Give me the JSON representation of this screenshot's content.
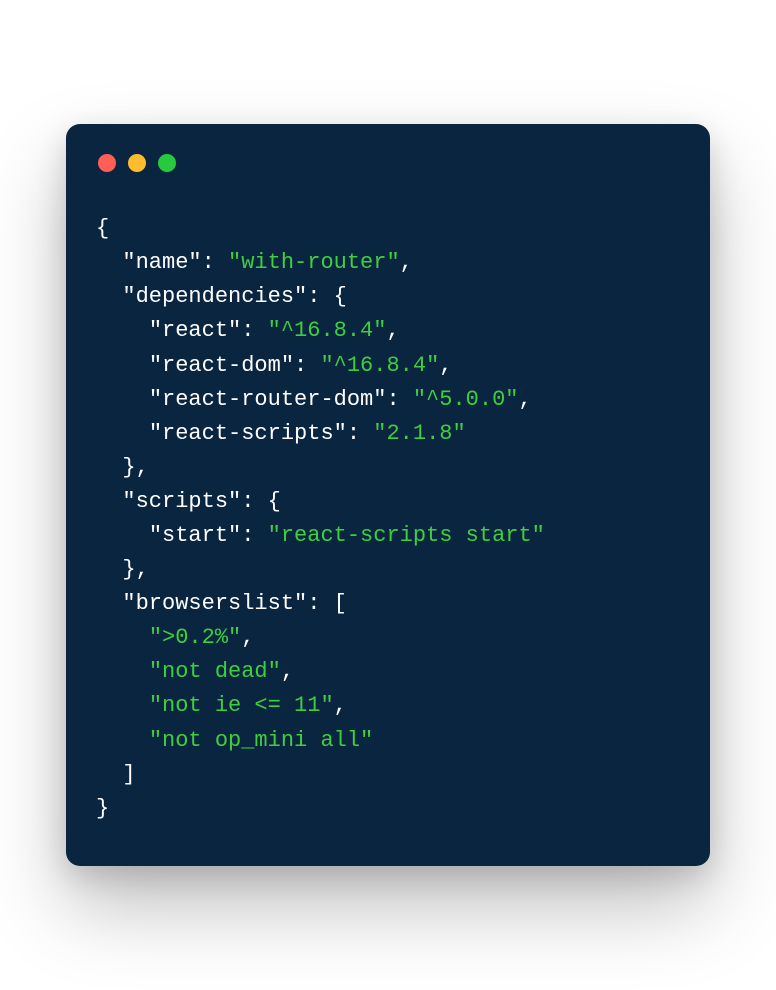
{
  "code": {
    "name_key": "\"name\"",
    "name_val": "\"with-router\"",
    "deps_key": "\"dependencies\"",
    "react_key": "\"react\"",
    "react_val": "\"^16.8.4\"",
    "reactdom_key": "\"react-dom\"",
    "reactdom_val": "\"^16.8.4\"",
    "rrouter_key": "\"react-router-dom\"",
    "rrouter_val": "\"^5.0.0\"",
    "rscripts_key": "\"react-scripts\"",
    "rscripts_val": "\"2.1.8\"",
    "scripts_key": "\"scripts\"",
    "start_key": "\"start\"",
    "start_val": "\"react-scripts start\"",
    "browsers_key": "\"browserslist\"",
    "b0": "\">0.2%\"",
    "b1": "\"not dead\"",
    "b2": "\"not ie <= 11\"",
    "b3": "\"not op_mini all\"",
    "open_brace": "{",
    "close_brace": "}",
    "open_bracket": "[",
    "close_bracket": "]",
    "colon_space": ": ",
    "comma": ","
  }
}
